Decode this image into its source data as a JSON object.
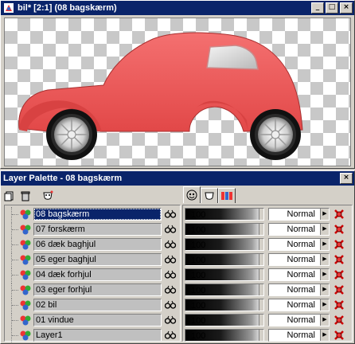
{
  "image_window": {
    "title": "bil* [2:1] (08 bagskærm)",
    "buttons": {
      "minimize": "_",
      "maximize": "□",
      "close": "×"
    }
  },
  "palette": {
    "title": "Layer Palette - 08 bagskærm",
    "close": "×",
    "tabs": [
      "layers-visibility-icon",
      "mask-icon",
      "layer-color-icon"
    ],
    "layers": [
      {
        "name": "08 bagskærm",
        "opacity": "100",
        "blend": "Normal",
        "selected": true
      },
      {
        "name": "07 forskærm",
        "opacity": "100",
        "blend": "Normal"
      },
      {
        "name": "06 dæk baghjul",
        "opacity": "100",
        "blend": "Normal"
      },
      {
        "name": "05 eger baghjul",
        "opacity": "100",
        "blend": "Normal"
      },
      {
        "name": "04 dæk forhjul",
        "opacity": "100",
        "blend": "Normal"
      },
      {
        "name": "03 eger forhjul",
        "opacity": "100",
        "blend": "Normal"
      },
      {
        "name": "02 bil",
        "opacity": "100",
        "blend": "Normal"
      },
      {
        "name": "01 vindue",
        "opacity": "100",
        "blend": "Normal"
      },
      {
        "name": "Layer1",
        "opacity": "100",
        "blend": "Normal"
      }
    ]
  },
  "colors": {
    "titlebar": "#0a246a",
    "car_body": "#ee5a5a",
    "selection": "#0a246a"
  }
}
